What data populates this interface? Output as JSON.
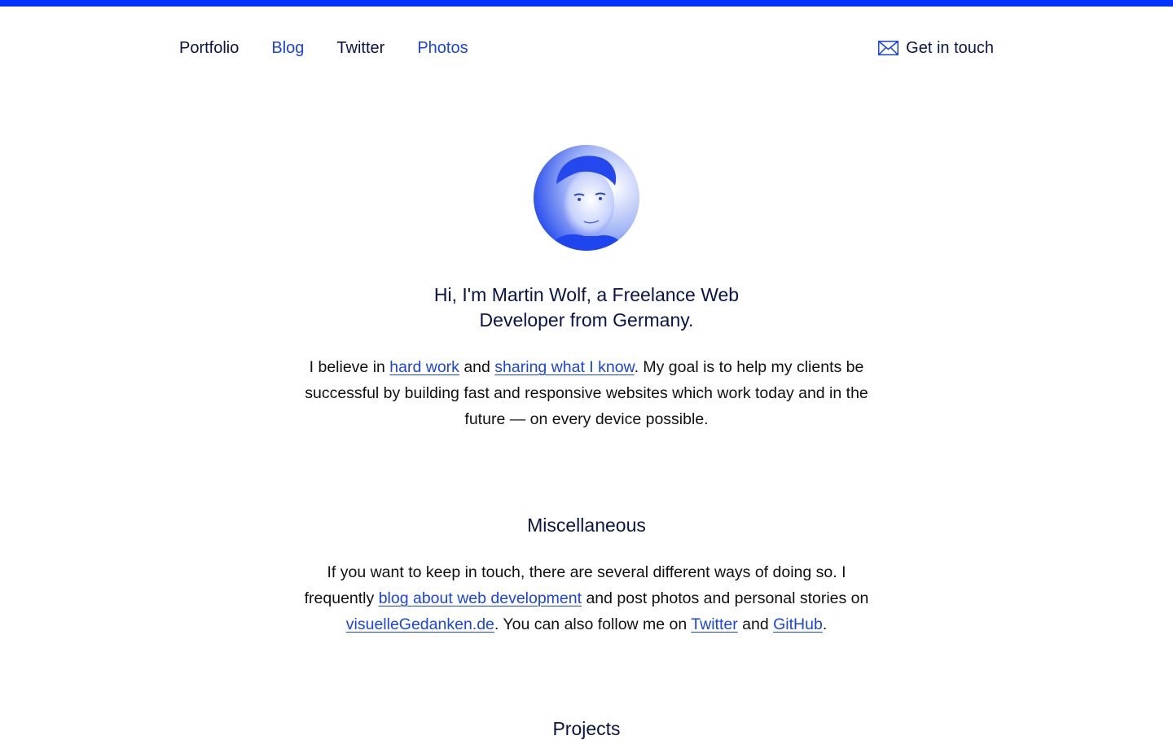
{
  "nav": {
    "items": [
      {
        "label": "Portfolio"
      },
      {
        "label": "Blog"
      },
      {
        "label": "Twitter"
      },
      {
        "label": "Photos"
      }
    ],
    "contact": {
      "label": "Get in touch",
      "icon": "mail-icon"
    }
  },
  "colors": {
    "accent": "#1a44e8",
    "top_bar": "#0033ff",
    "heading": "#0a1446"
  },
  "hero": {
    "title_line1": "Hi, I'm Martin Wolf, a Freelance Web",
    "title_line2": "Developer from Germany.",
    "p1": {
      "t1": "I believe in ",
      "link_hard_work": "hard work",
      "t2": " and ",
      "link_sharing": "sharing what I know",
      "t3": ". My goal is to help my clients be successful by building fast and responsive websites which work today and in the future — on every device possible."
    }
  },
  "misc": {
    "heading": "Miscellaneous",
    "t1": "If you want to keep in touch, there are several different ways of doing so. I frequently ",
    "link_blog": "blog about web development",
    "t2": " and post photos and personal stories on ",
    "link_visuelle": "visuelleGedanken.de",
    "t3": ". You can also follow me on ",
    "link_twitter": "Twitter",
    "t4": " and ",
    "link_github": "GitHub",
    "t5": "."
  },
  "projects": {
    "heading": "Projects"
  }
}
